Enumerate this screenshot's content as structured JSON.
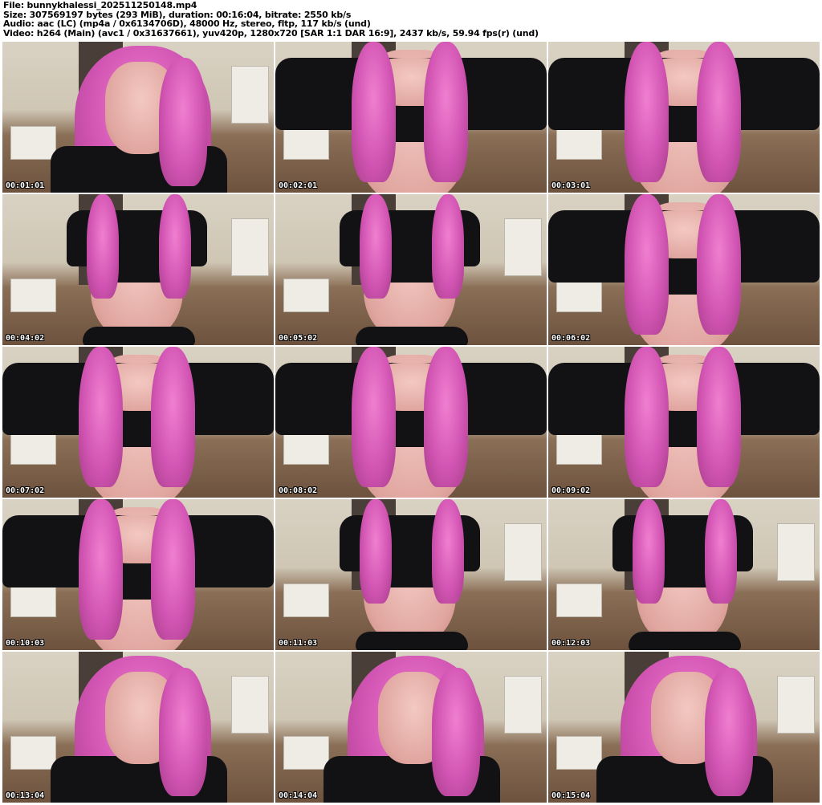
{
  "header": {
    "file": "File: bunnykhalessi_202511250148.mp4",
    "size": "Size: 307569197 bytes (293 MiB), duration: 00:16:04, bitrate: 2550 kb/s",
    "audio": "Audio: aac (LC) (mp4a / 0x6134706D), 48000 Hz, stereo, fltp, 117 kb/s (und)",
    "video": "Video: h264 (Main) (avc1 / 0x31637661), yuv420p, 1280x720 [SAR 1:1 DAR 16:9], 2437 kb/s, 59.94 fps(r) (und)"
  },
  "thumbnails": [
    {
      "timestamp": "00:01:01",
      "shot": "face"
    },
    {
      "timestamp": "00:02:01",
      "shot": "torso"
    },
    {
      "timestamp": "00:03:01",
      "shot": "torso"
    },
    {
      "timestamp": "00:04:02",
      "shot": "seated"
    },
    {
      "timestamp": "00:05:02",
      "shot": "seated"
    },
    {
      "timestamp": "00:06:02",
      "shot": "torso"
    },
    {
      "timestamp": "00:07:02",
      "shot": "torso"
    },
    {
      "timestamp": "00:08:02",
      "shot": "torso"
    },
    {
      "timestamp": "00:09:02",
      "shot": "torso"
    },
    {
      "timestamp": "00:10:03",
      "shot": "torso"
    },
    {
      "timestamp": "00:11:03",
      "shot": "seated"
    },
    {
      "timestamp": "00:12:03",
      "shot": "seated"
    },
    {
      "timestamp": "00:13:04",
      "shot": "face"
    },
    {
      "timestamp": "00:14:04",
      "shot": "face"
    },
    {
      "timestamp": "00:15:04",
      "shot": "face"
    }
  ],
  "colors": {
    "background": "#ffffff",
    "hair": "#d255b3",
    "clothing": "#121114",
    "timestamp_text": "#ffffff"
  }
}
